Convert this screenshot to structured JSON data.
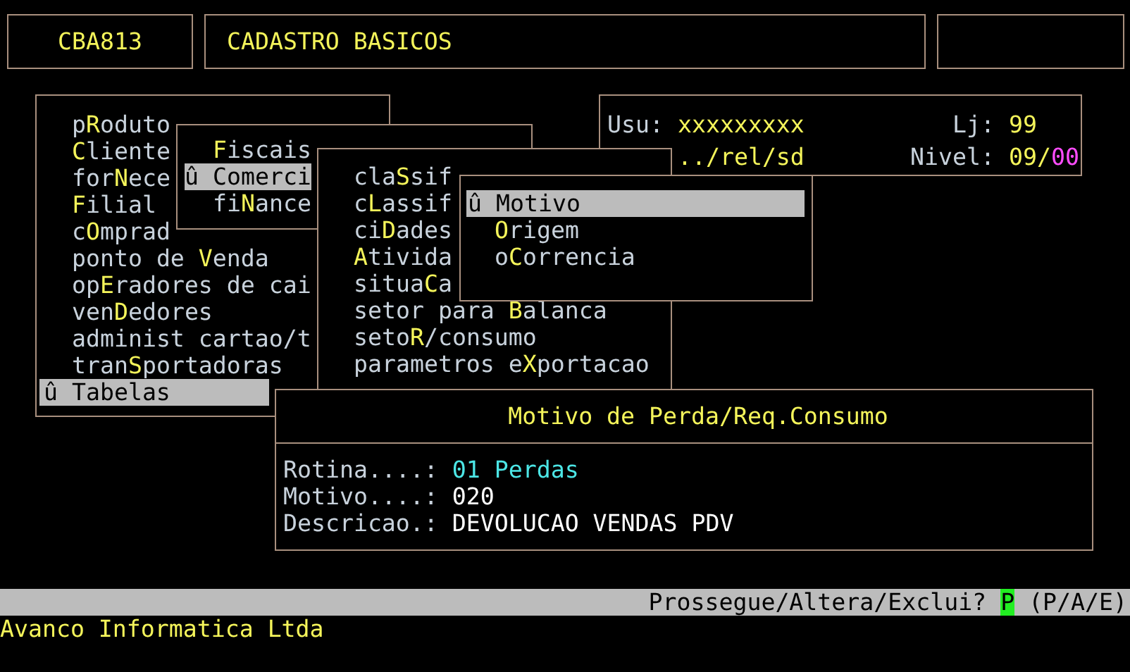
{
  "header": {
    "code": "CBA813",
    "title": "CADASTRO BASICOS"
  },
  "session": {
    "user_label": "Usu:",
    "user": "xxxxxxxxx",
    "store_label": "Lj:",
    "store": "99",
    "path": "../rel/sd",
    "nivel_label": "Nivel:",
    "nivel_main": "09/",
    "nivel_sub": "00"
  },
  "menus": [
    {
      "items": [
        {
          "pre": "p",
          "key": "R",
          "post": "oduto",
          "selected": false
        },
        {
          "key": "C",
          "post": "liente",
          "selected": false
        },
        {
          "pre": "for",
          "key": "N",
          "post": "ece",
          "selected": false
        },
        {
          "key": "F",
          "post": "ilial",
          "selected": false
        },
        {
          "pre": "c",
          "key": "O",
          "post": "mprad",
          "selected": false
        },
        {
          "pre": "ponto de ",
          "key": "V",
          "post": "enda",
          "selected": false
        },
        {
          "pre": "op",
          "key": "E",
          "post": "radores de cai",
          "selected": false
        },
        {
          "pre": "ven",
          "key": "D",
          "post": "edores",
          "selected": false
        },
        {
          "pre": "administ cartao/t",
          "selected": false
        },
        {
          "pre": "tran",
          "key": "S",
          "post": "portadoras",
          "selected": false
        },
        {
          "pre": "û ",
          "key": "T",
          "post": "abelas",
          "selected": true
        }
      ]
    },
    {
      "items": [
        {
          "key": "F",
          "post": "iscais",
          "selected": false
        },
        {
          "pre": "û ",
          "key": "C",
          "post": "omerci",
          "selected": true
        },
        {
          "pre": "fi",
          "key": "N",
          "post": "ance",
          "selected": false
        }
      ]
    },
    {
      "items": [
        {
          "pre": "cla",
          "key": "S",
          "post": "sif",
          "selected": false
        },
        {
          "pre": "c",
          "key": "L",
          "post": "assif",
          "selected": false
        },
        {
          "pre": "ci",
          "key": "D",
          "post": "ades",
          "selected": false
        },
        {
          "key": "A",
          "post": "tivida",
          "selected": false
        },
        {
          "pre": "situa",
          "key": "C",
          "post": "a",
          "selected": false
        },
        {
          "pre": "setor para ",
          "key": "B",
          "post": "alanca",
          "selected": false
        },
        {
          "pre": "seto",
          "key": "R",
          "post": "/consumo",
          "selected": false
        },
        {
          "pre": "parametros e",
          "key": "X",
          "post": "portacao",
          "selected": false
        }
      ]
    },
    {
      "items": [
        {
          "pre": "û ",
          "key": "M",
          "post": "otivo",
          "selected": true
        },
        {
          "key": "O",
          "post": "rigem",
          "selected": false
        },
        {
          "pre": "o",
          "key": "C",
          "post": "orrencia",
          "selected": false
        }
      ]
    }
  ],
  "form": {
    "title": "Motivo de Perda/Req.Consumo",
    "fields": [
      {
        "label": "Rotina....:",
        "value": "01 Perdas",
        "kind": "lookup"
      },
      {
        "label": "Motivo....:",
        "value": "020",
        "kind": "text"
      },
      {
        "label": "Descricao.:",
        "value": "DEVOLUCAO VENDAS PDV",
        "kind": "text"
      }
    ]
  },
  "prompt": {
    "question": "Prossegue/Altera/Exclui?",
    "answer": "P",
    "options": "(P/A/E)"
  },
  "footer": "Avanco Informatica Ltda"
}
